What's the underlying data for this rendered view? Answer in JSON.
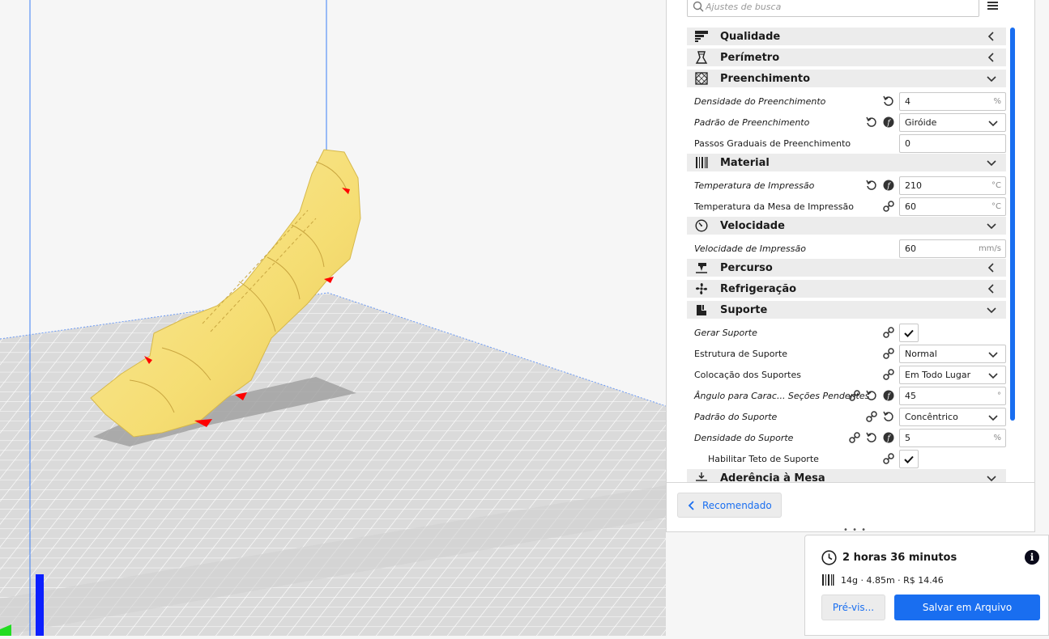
{
  "colors": {
    "accent": "#196ef0",
    "model": "#f7e27f",
    "overhang": "#ff0000",
    "build_plate": "#dcdcdc",
    "grid": "#ffffff"
  },
  "search": {
    "placeholder": "Ajustes de busca",
    "icon": "search-icon"
  },
  "menu_icon": "hamburger-menu-icon",
  "categories": {
    "qualidade": {
      "label": "Qualidade",
      "icon": "quality-icon",
      "state": "collapsed"
    },
    "perimetro": {
      "label": "Perímetro",
      "icon": "perimeter-icon",
      "state": "collapsed"
    },
    "preenchimento": {
      "label": "Preenchimento",
      "icon": "infill-icon",
      "state": "expanded"
    },
    "material": {
      "label": "Material",
      "icon": "material-icon",
      "state": "expanded"
    },
    "velocidade": {
      "label": "Velocidade",
      "icon": "speed-icon",
      "state": "expanded"
    },
    "percurso": {
      "label": "Percurso",
      "icon": "travel-icon",
      "state": "collapsed"
    },
    "refrigeracao": {
      "label": "Refrigeração",
      "icon": "cooling-icon",
      "state": "collapsed"
    },
    "suporte": {
      "label": "Suporte",
      "icon": "support-icon",
      "state": "expanded"
    },
    "aderencia": {
      "label": "Aderência à Mesa",
      "icon": "adhesion-icon",
      "state": "expanded"
    }
  },
  "settings": {
    "densidade_preenchimento": {
      "label": "Densidade do Preenchimento",
      "value": "4",
      "unit": "%"
    },
    "padrao_preenchimento": {
      "label": "Padrão de Preenchimento",
      "value": "Giróide"
    },
    "passos_graduais": {
      "label": "Passos Graduais de Preenchimento",
      "value": "0"
    },
    "temperatura_impressao": {
      "label": "Temperatura de Impressão",
      "value": "210",
      "unit": "°C"
    },
    "temperatura_mesa": {
      "label": "Temperatura da Mesa de Impressão",
      "value": "60",
      "unit": "°C"
    },
    "velocidade_impressao": {
      "label": "Velocidade de Impressão",
      "value": "60",
      "unit": "mm/s"
    },
    "gerar_suporte": {
      "label": "Gerar Suporte",
      "checked": true
    },
    "estrutura_suporte": {
      "label": "Estrutura de Suporte",
      "value": "Normal"
    },
    "colocacao_suportes": {
      "label": "Colocação dos Suportes",
      "value": "Em Todo Lugar"
    },
    "angulo_secoes": {
      "label": "Ângulo para Carac... Seções Pendentes",
      "value": "45",
      "unit": "°"
    },
    "padrao_suporte": {
      "label": "Padrão do Suporte",
      "value": "Concêntrico"
    },
    "densidade_suporte": {
      "label": "Densidade do Suporte",
      "value": "5",
      "unit": "%"
    },
    "teto_suporte": {
      "label": "Habilitar Teto de Suporte",
      "checked": true
    }
  },
  "recommended_button": {
    "label": "Recomendado"
  },
  "estimate": {
    "time": "2 horas 36 minutos",
    "material": "14g · 4.85m · R$ 14.46",
    "preview_label": "Pré-vis...",
    "save_label": "Salvar em Arquivo"
  }
}
